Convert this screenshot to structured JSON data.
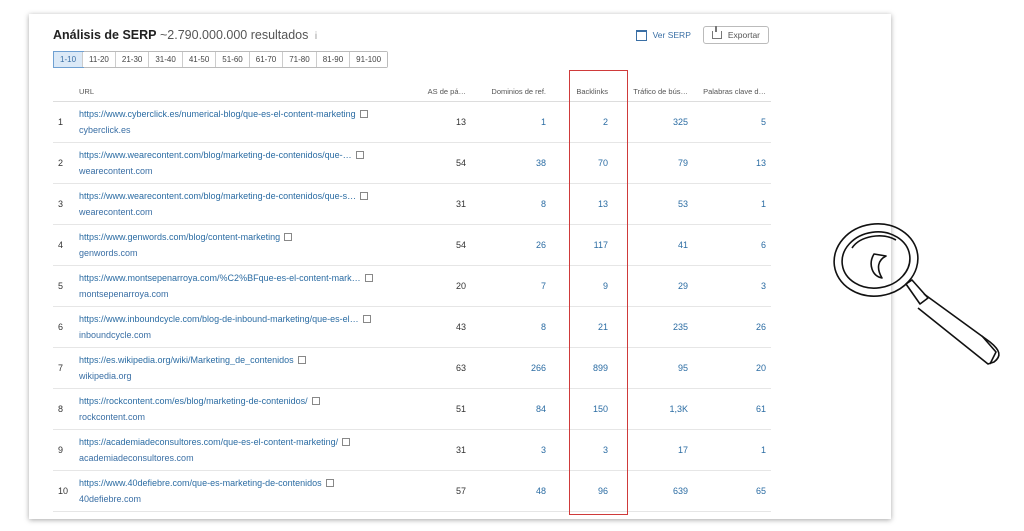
{
  "header": {
    "title": "Análisis de SERP",
    "results": "~2.790.000.000 resultados",
    "info_glyph": "i"
  },
  "actions": {
    "ver_serp": "Ver SERP",
    "export": "Exportar"
  },
  "pagination": [
    "1-10",
    "11-20",
    "21-30",
    "31-40",
    "41-50",
    "51-60",
    "61-70",
    "71-80",
    "81-90",
    "91-100"
  ],
  "columns": {
    "url": "URL",
    "as": "AS de pá…",
    "dom": "Dominios de ref.",
    "back": "Backlinks",
    "traf": "Tráfico de bús…",
    "kw": "Palabras clave d…"
  },
  "rows": [
    {
      "n": "1",
      "url": "https://www.cyberclick.es/numerical-blog/que-es-el-content-marketing",
      "domain": "cyberclick.es",
      "as": "13",
      "dom": "1",
      "back": "2",
      "traf": "325",
      "kw": "5"
    },
    {
      "n": "2",
      "url": "https://www.wearecontent.com/blog/marketing-de-contenidos/que-…",
      "domain": "wearecontent.com",
      "as": "54",
      "dom": "38",
      "back": "70",
      "traf": "79",
      "kw": "13"
    },
    {
      "n": "3",
      "url": "https://www.wearecontent.com/blog/marketing-de-contenidos/que-s…",
      "domain": "wearecontent.com",
      "as": "31",
      "dom": "8",
      "back": "13",
      "traf": "53",
      "kw": "1"
    },
    {
      "n": "4",
      "url": "https://www.genwords.com/blog/content-marketing",
      "domain": "genwords.com",
      "as": "54",
      "dom": "26",
      "back": "117",
      "traf": "41",
      "kw": "6"
    },
    {
      "n": "5",
      "url": "https://www.montsepenarroya.com/%C2%BFque-es-el-content-mark…",
      "domain": "montsepenarroya.com",
      "as": "20",
      "dom": "7",
      "back": "9",
      "traf": "29",
      "kw": "3"
    },
    {
      "n": "6",
      "url": "https://www.inboundcycle.com/blog-de-inbound-marketing/que-es-el…",
      "domain": "inboundcycle.com",
      "as": "43",
      "dom": "8",
      "back": "21",
      "traf": "235",
      "kw": "26"
    },
    {
      "n": "7",
      "url": "https://es.wikipedia.org/wiki/Marketing_de_contenidos",
      "domain": "wikipedia.org",
      "as": "63",
      "dom": "266",
      "back": "899",
      "traf": "95",
      "kw": "20"
    },
    {
      "n": "8",
      "url": "https://rockcontent.com/es/blog/marketing-de-contenidos/",
      "domain": "rockcontent.com",
      "as": "51",
      "dom": "84",
      "back": "150",
      "traf": "1,3K",
      "kw": "61"
    },
    {
      "n": "9",
      "url": "https://academiadeconsultores.com/que-es-el-content-marketing/",
      "domain": "academiadeconsultores.com",
      "as": "31",
      "dom": "3",
      "back": "3",
      "traf": "17",
      "kw": "1"
    },
    {
      "n": "10",
      "url": "https://www.40defiebre.com/que-es-marketing-de-contenidos",
      "domain": "40defiebre.com",
      "as": "57",
      "dom": "48",
      "back": "96",
      "traf": "639",
      "kw": "65"
    }
  ],
  "colors": {
    "link": "#2b6ca3",
    "highlight": "#cf3a3a"
  }
}
